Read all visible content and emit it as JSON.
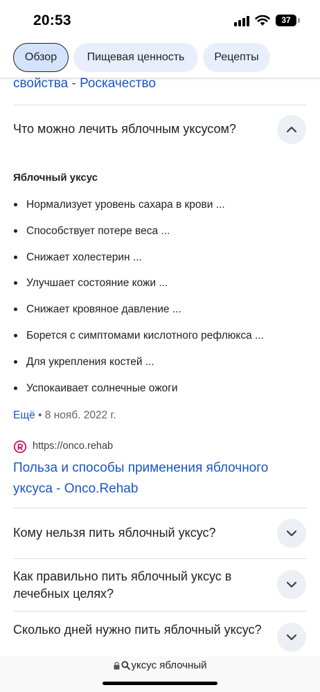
{
  "status_bar": {
    "time": "20:53",
    "battery_level": "37",
    "icons": [
      "cellular-signal-icon",
      "wifi-icon",
      "battery-icon"
    ]
  },
  "tabs": [
    {
      "label": "Обзор",
      "active": true
    },
    {
      "label": "Пищевая ценность",
      "active": false
    },
    {
      "label": "Рецепты",
      "active": false
    }
  ],
  "partial_link": "свойства - Роскачество",
  "expanded_question": {
    "question": "Что можно лечить яблочным уксусом?",
    "answer_title": "Яблочный уксус",
    "items": [
      "Нормализует уровень сахара в крови ...",
      "Способствует потере веса ...",
      "Снижает холестерин ...",
      "Улучшает состояние кожи ...",
      "Снижает кровяное давление ...",
      "Борется с симптомами кислотного рефлюкса ...",
      "Для укрепления костей ...",
      "Успокаивает солнечные ожоги"
    ],
    "more_label": "Ещё",
    "separator": "•",
    "date": "8 нояб. 2022 г."
  },
  "source": {
    "url": "https://onco.rehab",
    "title": "Польза и способы применения яблочного уксуса - Onco.Rehab"
  },
  "collapsed_questions": [
    "Кому нельзя пить яблочный уксус?",
    "Как правильно пить яблочный уксус в лечебных целях?",
    "Сколько дней нужно пить яблочный уксус?"
  ],
  "address_bar": {
    "text": "уксус яблочный",
    "icons": [
      "lock-icon",
      "search-icon"
    ]
  },
  "colors": {
    "link": "#1a56c4",
    "tab_background": "#e8eefc",
    "tab_active_background": "#d3e3fd",
    "chevron_button": "#eceff3",
    "source_icon": "#c2185b"
  }
}
